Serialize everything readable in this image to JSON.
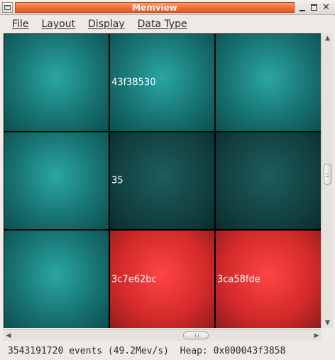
{
  "window": {
    "title": "Memview",
    "icons": {
      "menu": "window-menu-icon",
      "minimize": "minimize-icon",
      "maximize": "maximize-icon",
      "close": "close-icon"
    }
  },
  "menubar": {
    "items": [
      {
        "label": "File"
      },
      {
        "label": "Layout"
      },
      {
        "label": "Display"
      },
      {
        "label": "Data Type"
      }
    ]
  },
  "grid": {
    "colors": {
      "teal": "#1f8c8a",
      "dark": "#164a4a",
      "red": "#f23030"
    },
    "rows": [
      [
        {
          "color": "teal",
          "label": ""
        },
        {
          "color": "teal",
          "label": "43f38530"
        },
        {
          "color": "teal",
          "label": ""
        }
      ],
      [
        {
          "color": "teal",
          "label": ""
        },
        {
          "color": "dark",
          "label": "35"
        },
        {
          "color": "dark",
          "label": ""
        }
      ],
      [
        {
          "color": "teal",
          "label": ""
        },
        {
          "color": "red",
          "label": "3c7e62bc"
        },
        {
          "color": "red",
          "label": "3ca58fde"
        }
      ]
    ]
  },
  "status": {
    "text": "3543191720 events (49.2Mev/s)  Heap: 0x000043f3858"
  }
}
